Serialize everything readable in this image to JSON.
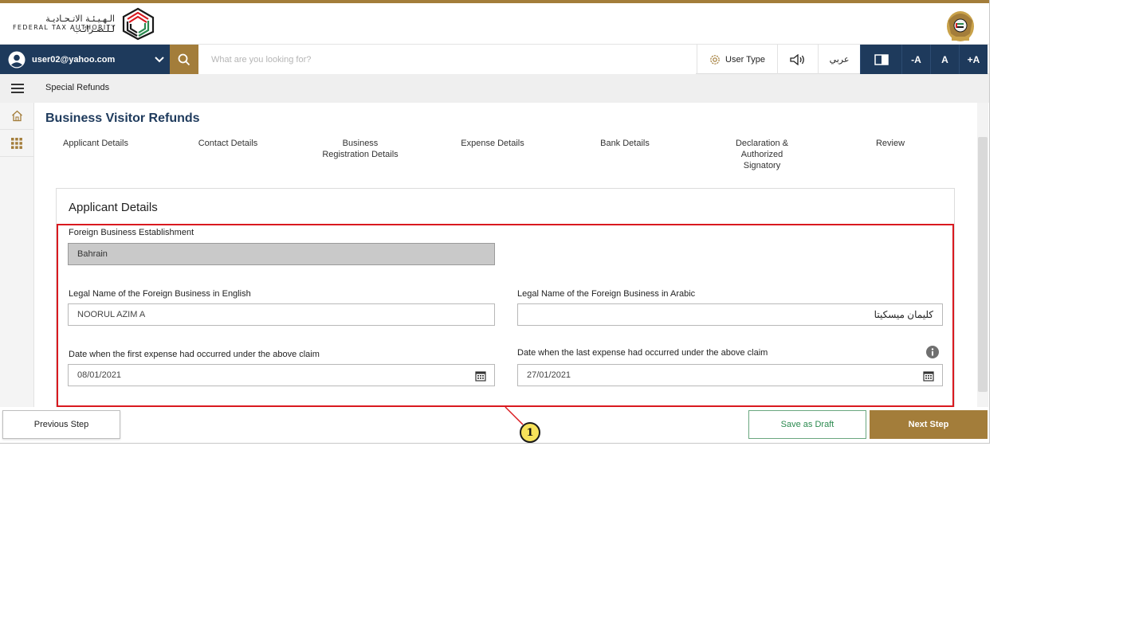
{
  "colors": {
    "brand_gold": "#a37d3a",
    "navy": "#1e3a5c",
    "highlight_red": "#d9191f",
    "draft_green": "#2b8a4f"
  },
  "header": {
    "logo_arabic": "الـهـيـئـة الاتـحـاديـة لـلـضـرائـب",
    "logo_english": "FEDERAL TAX AUTHORITY",
    "logo_icon": "fta-logo-icon",
    "emblem_icon": "uae-emblem-icon"
  },
  "nav": {
    "user_email": "user02@yahoo.com",
    "search_placeholder": "What are you looking for?",
    "user_type_label": "User Type",
    "language_label": "عربي",
    "font_decrease": "-A",
    "font_reset": "A",
    "font_increase": "+A"
  },
  "breadcrumb": {
    "label": "Special Refunds"
  },
  "page": {
    "title": "Business Visitor Refunds",
    "steps": [
      "Applicant Details",
      "Contact Details",
      "Business\nRegistration Details",
      "Expense Details",
      "Bank Details",
      "Declaration &\nAuthorized\nSignatory",
      "Review"
    ]
  },
  "form": {
    "section_title": "Applicant Details",
    "foreign_establishment_label": "Foreign Business Establishment",
    "foreign_establishment_value": "Bahrain",
    "legal_name_en_label": "Legal Name of the Foreign Business in English",
    "legal_name_en_value": "NOORUL AZIM A",
    "legal_name_ar_label": "Legal Name of the Foreign Business in Arabic",
    "legal_name_ar_value": "كليمان ميسكيتا",
    "first_expense_label": "Date when the first expense had occurred under the above claim",
    "first_expense_value": "08/01/2021",
    "last_expense_label": "Date when the last expense had occurred under the above claim",
    "last_expense_value": "27/01/2021"
  },
  "footer": {
    "previous_label": "Previous Step",
    "draft_label": "Save as Draft",
    "next_label": "Next Step"
  },
  "callout": {
    "number": "1"
  }
}
